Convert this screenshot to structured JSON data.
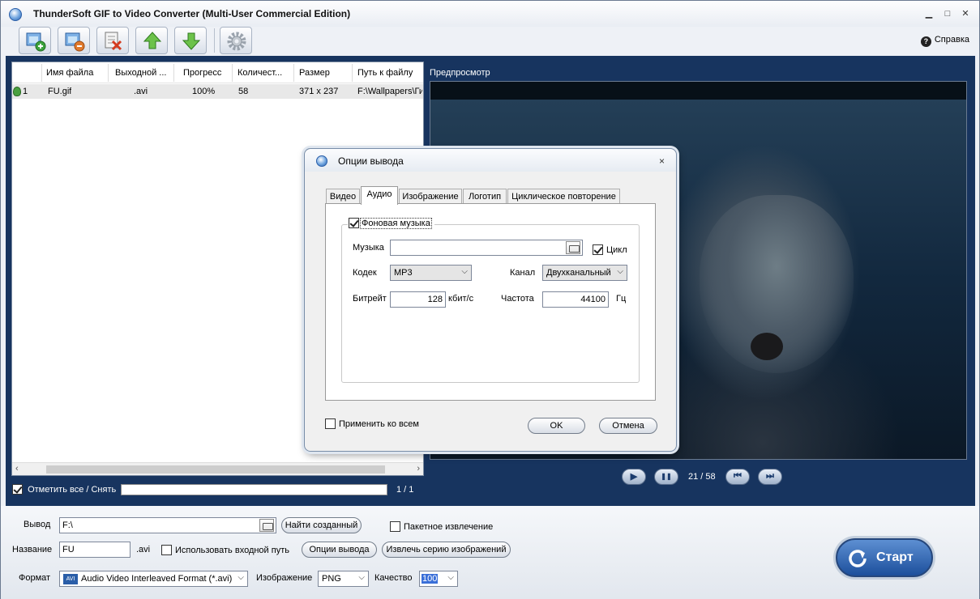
{
  "window": {
    "title": "ThunderSoft GIF to Video Converter (Multi-User Commercial Edition)",
    "controls": {
      "minimize": "▁",
      "maximize": "□",
      "close": "✕"
    }
  },
  "toolbar": {
    "buttons": [
      {
        "name": "add-files-icon"
      },
      {
        "name": "remove-file-icon"
      },
      {
        "name": "clear-list-icon"
      },
      {
        "name": "move-up-icon"
      },
      {
        "name": "move-down-icon"
      },
      {
        "name": "settings-gear-icon"
      }
    ],
    "help_label": "Справка"
  },
  "file_list": {
    "columns": [
      "Имя файла",
      "Выходной ...",
      "Прогресс",
      "Количест...",
      "Размер",
      "Путь к файлу"
    ],
    "rows": [
      {
        "index": "1",
        "name": "FU.gif",
        "output": ".avi",
        "progress": "100%",
        "count": "58",
        "size": "371 x 237",
        "path": "F:\\Wallpapers\\Ги"
      }
    ]
  },
  "select_all": {
    "label": "Отметить все / Снять",
    "checked": true,
    "page": "1 / 1"
  },
  "preview": {
    "label": "Предпросмотр",
    "frame": "21 / 58"
  },
  "playback": {
    "play": "▶",
    "pause": "❚❚",
    "first": "⏮",
    "last": "⏭"
  },
  "bottom": {
    "output_label": "Вывод",
    "output_value": "F:\\",
    "find_created": "Найти созданный",
    "batch_extract": "Пакетное извлечение",
    "name_label": "Название",
    "name_value": "FU",
    "name_ext": ".avi",
    "use_input_path": "Использовать входной путь",
    "output_options": "Опции вывода",
    "extract_series": "Извлечь серию изображений",
    "format_label": "Формат",
    "format_value": "Audio Video Interleaved Format (*.avi)",
    "format_badge": "AVI",
    "image_label": "Изображение",
    "image_value": "PNG",
    "quality_label": "Качество",
    "quality_value": "100",
    "start": "Старт"
  },
  "dialog": {
    "title": "Опции вывода",
    "close": "×",
    "tabs": [
      "Видео",
      "Аудио",
      "Изображение",
      "Логотип",
      "Циклическое повторение"
    ],
    "active_tab": "Аудио",
    "bg_music": {
      "label": "Фоновая музыка",
      "checked": true
    },
    "music_label": "Музыка",
    "music_value": "",
    "loop_label": "Цикл",
    "loop_checked": true,
    "codec_label": "Кодек",
    "codec_value": "MP3",
    "channel_label": "Канал",
    "channel_value": "Двухканальный",
    "bitrate_label": "Битрейт",
    "bitrate_value": "128",
    "bitrate_unit": "кбит/с",
    "freq_label": "Частота",
    "freq_value": "44100",
    "freq_unit": "Гц",
    "apply_all": "Применить ко всем",
    "ok": "OK",
    "cancel": "Отмена"
  },
  "colors": {
    "frame_blue": "#17345f",
    "accent": "#1c4f9c"
  }
}
